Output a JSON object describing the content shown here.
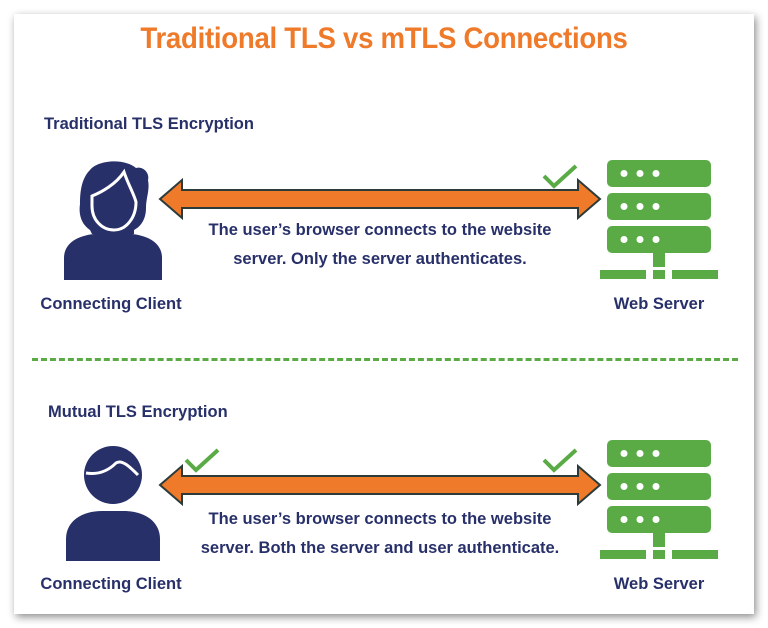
{
  "title": "Traditional TLS vs mTLS Connections",
  "colors": {
    "title": "#ee7a2a",
    "text": "#28306a",
    "person": "#28306a",
    "server": "#5aab46",
    "arrow_fill": "#ee7a2a",
    "arrow_outline": "#2b3b3a",
    "check": "#5aab46",
    "divider": "#5aab46"
  },
  "sections": [
    {
      "heading": "Traditional TLS Encryption",
      "client_label": "Connecting Client",
      "client_icon": "female-user-icon",
      "server_label": "Web Server",
      "server_icon": "server-rack-icon",
      "description_line1": "The user’s browser connects to the website",
      "description_line2": "server. Only the server authenticates.",
      "client_authenticated": false,
      "server_authenticated": true
    },
    {
      "heading": "Mutual TLS Encryption",
      "client_label": "Connecting Client",
      "client_icon": "male-user-icon",
      "server_label": "Web Server",
      "server_icon": "server-rack-icon",
      "description_line1": "The user’s browser connects to the website",
      "description_line2": "server. Both the server and user authenticate.",
      "client_authenticated": true,
      "server_authenticated": true
    }
  ]
}
